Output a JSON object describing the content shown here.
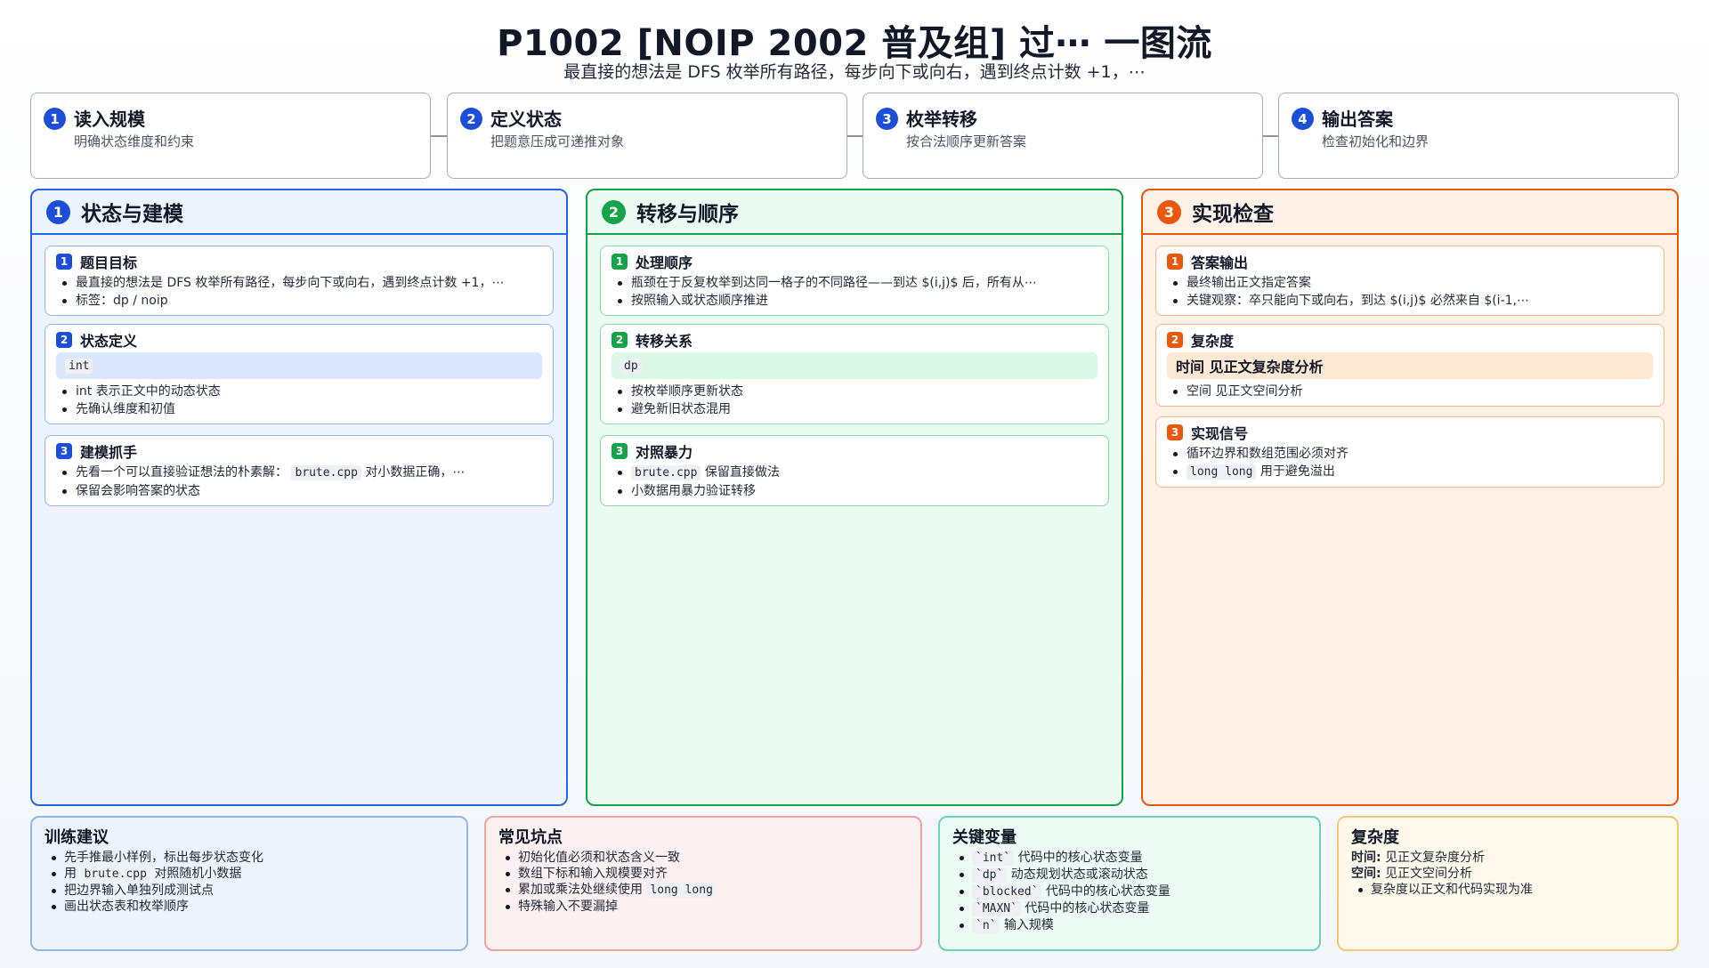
{
  "header": {
    "title": "P1002 [NOIP 2002 普及组] 过⋯ 一图流",
    "subtitle": "最直接的想法是 DFS 枚举所有路径，每步向下或向右，遇到终点计数 +1，⋯"
  },
  "steps": [
    {
      "num": "1",
      "title": "读入规模",
      "desc": "明确状态维度和约束"
    },
    {
      "num": "2",
      "title": "定义状态",
      "desc": "把题意压成可递推对象"
    },
    {
      "num": "3",
      "title": "枚举转移",
      "desc": "按合法顺序更新答案"
    },
    {
      "num": "4",
      "title": "输出答案",
      "desc": "检查初始化和边界"
    }
  ],
  "col1": {
    "num": "1",
    "title": "状态与建模",
    "card1": {
      "num": "1",
      "title": "题目目标",
      "b1": "最直接的想法是 DFS 枚举所有路径，每步向下或向右，遇到终点计数 +1，⋯",
      "b2": "标签：dp / noip"
    },
    "card2": {
      "num": "2",
      "title": "状态定义",
      "code": "int",
      "b1": "int 表示正文中的动态状态",
      "b2": "先确认维度和初值"
    },
    "card3": {
      "num": "3",
      "title": "建模抓手",
      "b1_pre": "先看一个可以直接验证想法的朴素解：",
      "b1_code": "brute.cpp",
      "b1_post": "对小数据正确，⋯",
      "b2": "保留会影响答案的状态"
    }
  },
  "col2": {
    "num": "2",
    "title": "转移与顺序",
    "card1": {
      "num": "1",
      "title": "处理顺序",
      "b1": "瓶颈在于反复枚举到达同一格子的不同路径——到达 $(i,j)$ 后，所有从⋯",
      "b2": "按照输入或状态顺序推进"
    },
    "card2": {
      "num": "2",
      "title": "转移关系",
      "code": "dp",
      "b1": "按枚举顺序更新状态",
      "b2": "避免新旧状态混用"
    },
    "card3": {
      "num": "3",
      "title": "对照暴力",
      "b1_code": "brute.cpp",
      "b1_post": "保留直接做法",
      "b2": "小数据用暴力验证转移"
    }
  },
  "col3": {
    "num": "3",
    "title": "实现检查",
    "card1": {
      "num": "1",
      "title": "答案输出",
      "b1": "最终输出正文指定答案",
      "b2": "关键观察：卒只能向下或向右，到达 $(i,j)$ 必然来自 $(i-1,⋯"
    },
    "card2": {
      "num": "2",
      "title": "复杂度",
      "highlight": "时间 见正文复杂度分析",
      "b1": "空间 见正文空间分析"
    },
    "card3": {
      "num": "3",
      "title": "实现信号",
      "b1": "循环边界和数组范围必须对齐",
      "b2_code": "long long",
      "b2_post": "用于避免溢出"
    }
  },
  "bottom": {
    "training": {
      "title": "训练建议",
      "i1": "先手推最小样例，标出每步状态变化",
      "i2_pre": "用",
      "i2_code": "brute.cpp",
      "i2_post": "对照随机小数据",
      "i3": "把边界输入单独列成测试点",
      "i4": "画出状态表和枚举顺序"
    },
    "pitfalls": {
      "title": "常见坑点",
      "i1": "初始化值必须和状态含义一致",
      "i2": "数组下标和输入规模要对齐",
      "i3_pre": "累加或乘法处继续使用",
      "i3_code": "long long",
      "i4": "特殊输入不要漏掉"
    },
    "vars": {
      "title": "关键变量",
      "i1_code": "`int`",
      "i1": "代码中的核心状态变量",
      "i2_code": "`dp`",
      "i2": "动态规划状态或滚动状态",
      "i3_code": "`blocked`",
      "i3": "代码中的核心状态变量",
      "i4_code": "`MAXN`",
      "i4": "代码中的核心状态变量",
      "i5_code": "`n`",
      "i5": "输入规模"
    },
    "complexity": {
      "title": "复杂度",
      "time_label": "时间:",
      "time": "见正文复杂度分析",
      "space_label": "空间:",
      "space": "见正文空间分析",
      "note": "复杂度以正文和代码实现为准"
    }
  },
  "colors": {
    "blue": "#1d4ed8",
    "green": "#16a34a",
    "orange": "#ea580c"
  }
}
